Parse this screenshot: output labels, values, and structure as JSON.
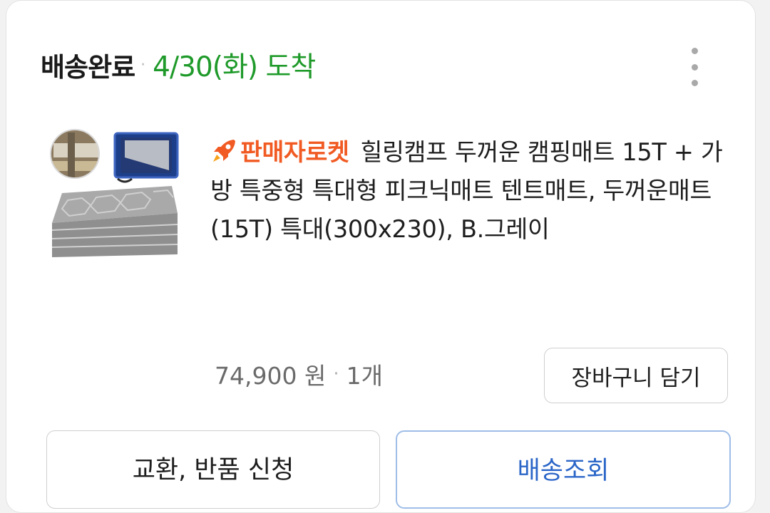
{
  "order": {
    "status_label": "배송완료",
    "separator": "·",
    "arrival_text": "4/30(화) 도착"
  },
  "product": {
    "badge_label": "판매자로켓",
    "title": "힐링캠프 두꺼운 캠핑매트 15T + 가방 특중형 특대형 피크닉매트 텐트매트, 두꺼운매트(15T) 특대(300x230), B.그레이",
    "price": "74,900 원",
    "separator": "·",
    "quantity": "1개"
  },
  "actions": {
    "add_to_cart_label": "장바구니 담기",
    "exchange_return_label": "교환, 반품 신청",
    "track_delivery_label": "배송조회"
  },
  "colors": {
    "arrival_green": "#1f9a2a",
    "rocket_orange": "#f15a22",
    "track_blue": "#2b66c8",
    "track_border": "#9fbde8"
  },
  "icons": {
    "menu": "more-vertical-icon",
    "badge": "rocket-icon"
  }
}
